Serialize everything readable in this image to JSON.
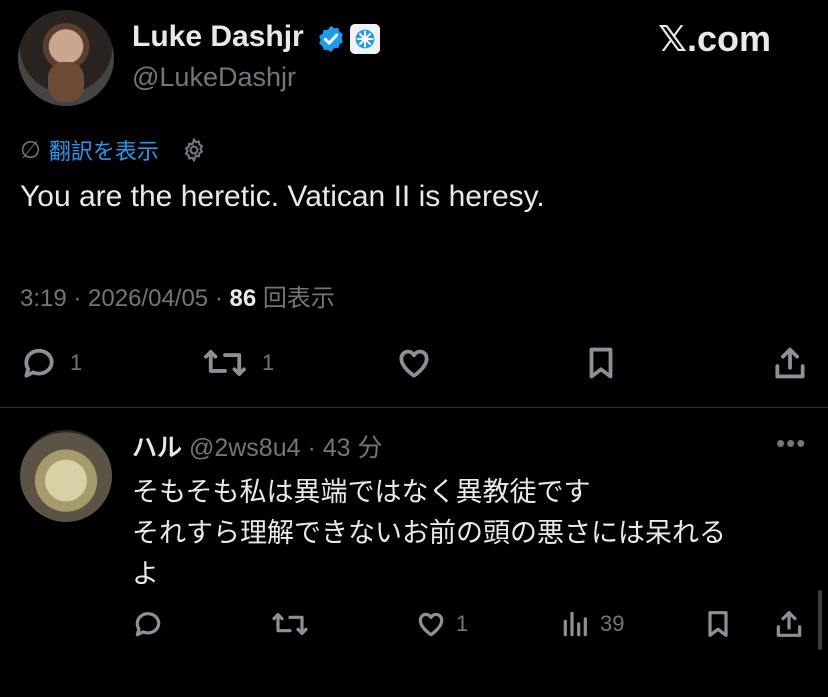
{
  "author": {
    "name": "Luke Dashjr",
    "handle": "@LukeDashjr"
  },
  "watermark": "𝕏.com",
  "translate": {
    "label": "翻訳を表示"
  },
  "tweet": {
    "text": "You are the heretic. Vatican II is heresy.",
    "time": "3:19 · 2026/04/05 · ",
    "views_count": "86",
    "views_label": " 回表示"
  },
  "main_actions": {
    "reply_count": "1",
    "repost_count": "1"
  },
  "reply": {
    "name": "ハル",
    "meta": " @2ws8u4 · 43 分",
    "lines": [
      "そもそも私は異端ではなく異教徒です",
      "それすら理解できないお前の頭の悪さには呆れる",
      "よ"
    ],
    "like_count": "1",
    "views_count": "39"
  },
  "colors": {
    "background": "#000000",
    "text": "#e7e9ea",
    "muted": "#71767b",
    "accent": "#1d9bf0",
    "divider": "#2f3336"
  }
}
